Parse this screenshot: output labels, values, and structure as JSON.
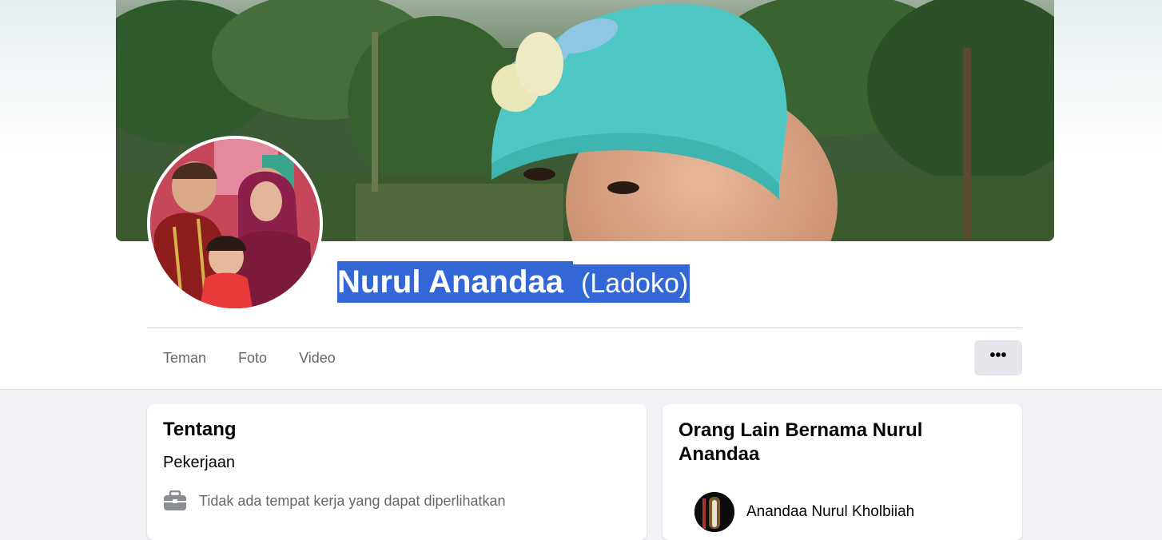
{
  "profile": {
    "name": "Nurul Anandaa",
    "alternate_name": "(Ladoko)"
  },
  "tabs": [
    {
      "label": "Teman"
    },
    {
      "label": "Foto"
    },
    {
      "label": "Video"
    }
  ],
  "more_button": {
    "label": "•••",
    "icon": "more-dots-icon"
  },
  "about_card": {
    "title": "Tentang",
    "section": "Pekerjaan",
    "work_icon": "briefcase-icon",
    "work_text": "Tidak ada tempat kerja yang dapat diperlihatkan"
  },
  "others_card": {
    "title": "Orang Lain Bernama Nurul Anandaa",
    "people": [
      {
        "name": "Anandaa Nurul Kholbiiah"
      }
    ]
  },
  "colors": {
    "selection": "#3367d6",
    "page_bg": "#f0f2f5",
    "secondary_text": "#65676b"
  }
}
